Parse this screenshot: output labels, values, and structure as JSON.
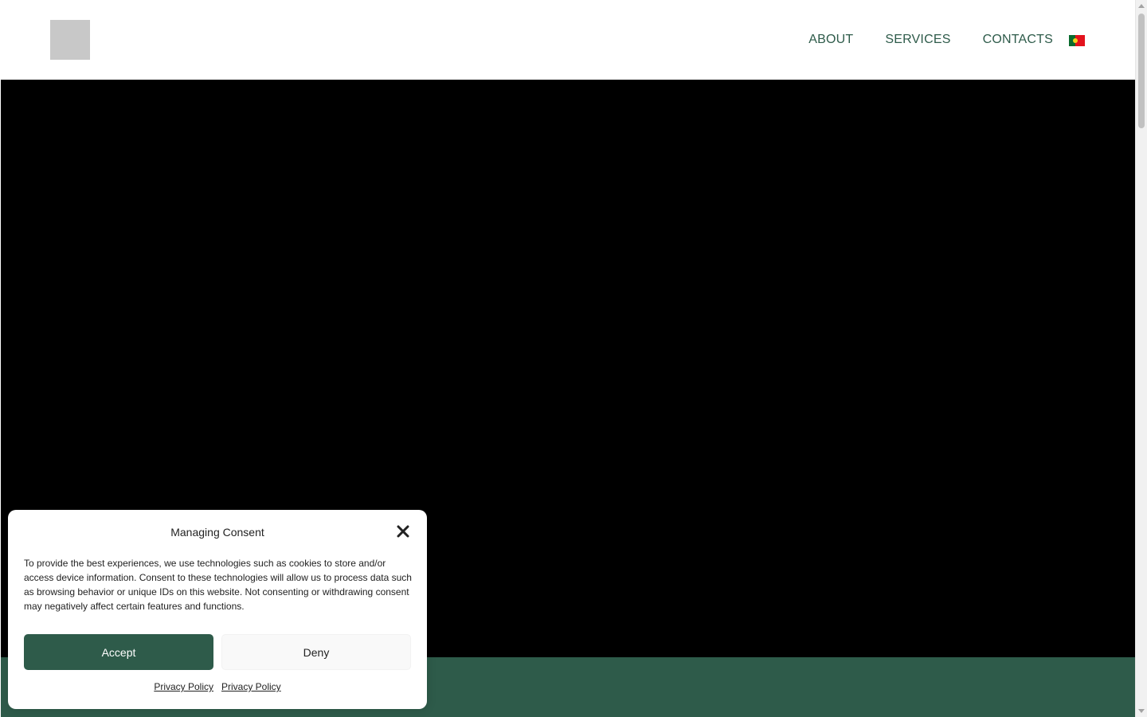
{
  "header": {
    "nav": [
      {
        "label": "ABOUT"
      },
      {
        "label": "SERVICES"
      },
      {
        "label": "CONTACTS"
      }
    ],
    "language_flag": "portugal-flag-icon"
  },
  "colors": {
    "brand_green": "#2e5b4a",
    "hero_background": "#000000",
    "logo_placeholder": "#c8c8c8"
  },
  "consent": {
    "title": "Managing Consent",
    "body": "To provide the best experiences, we use technologies such as cookies to store and/or access device information. Consent to these technologies will allow us to process data such as browsing behavior or unique IDs on this website. Not consenting or withdrawing consent may negatively affect certain features and functions.",
    "accept_label": "Accept",
    "deny_label": "Deny",
    "links": [
      {
        "label": "Privacy Policy"
      },
      {
        "label": "Privacy Policy"
      }
    ],
    "close_icon": "close-icon"
  }
}
